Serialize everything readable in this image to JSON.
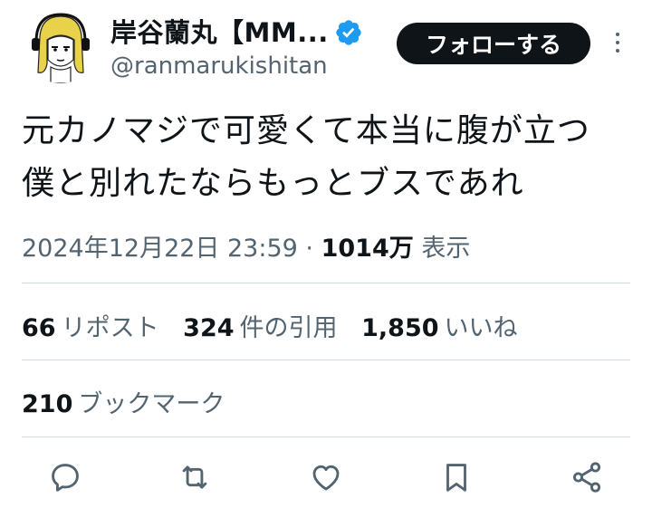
{
  "author": {
    "display_name": "岸谷蘭丸【MM...",
    "handle": "@ranmarukishitan",
    "verified": true
  },
  "follow_button": {
    "label": "フォローする"
  },
  "tweet": {
    "lines": [
      "元カノマジで可愛くて本当に腹が立つ",
      "僕と別れたならもっとブスであれ"
    ],
    "timestamp": "2024年12月22日 23:59",
    "separator": "·",
    "views_count": "1014万",
    "views_label": "表示"
  },
  "stats": {
    "reposts": {
      "count": "66",
      "label": "リポスト"
    },
    "quotes": {
      "count": "324",
      "label": "件の引用"
    },
    "likes": {
      "count": "1,850",
      "label": "いいね"
    },
    "bookmarks": {
      "count": "210",
      "label": "ブックマーク"
    }
  },
  "actions": [
    "reply-icon",
    "repost-icon",
    "like-icon",
    "bookmark-icon",
    "share-icon"
  ],
  "colors": {
    "text": "#0f1419",
    "secondary": "#536471",
    "divider": "#cfd9de",
    "verified": "#1d9bf0",
    "avatar_hair": "#e8d24a"
  }
}
